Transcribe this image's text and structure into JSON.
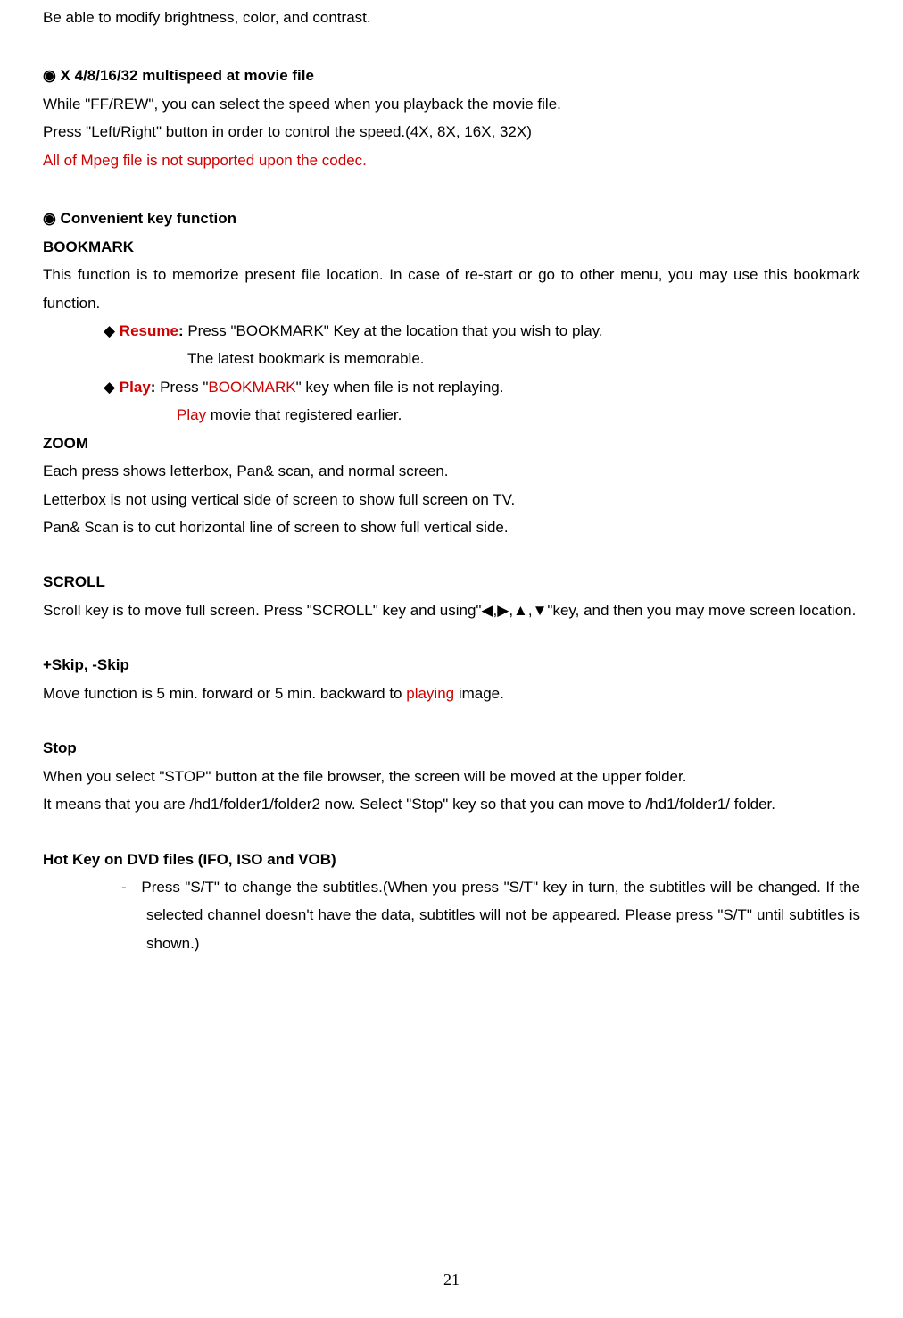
{
  "intro": "Be able to modify brightness, color, and contrast.",
  "sec1": {
    "title": "◉ X 4/8/16/32 multispeed at movie file",
    "l1": "While \"FF/REW\", you can select the speed when you playback the movie file.",
    "l2": "Press \"Left/Right\" button in order to control the speed.(4X, 8X, 16X, 32X)",
    "l3": "All of Mpeg file is not supported upon the codec."
  },
  "sec2": {
    "title": "◉ Convenient key function",
    "bookmark": {
      "h": "BOOKMARK",
      "desc": "This function is to memorize present file location. In case of re-start or go to other menu, you may use this bookmark function.",
      "resume_label": "Resume",
      "resume_rest": ": Press \"BOOKMARK\" Key at the location that you wish to play.",
      "resume_cont": "The latest bookmark is memorable.",
      "play_label": "Play",
      "play_pre": ": Press \"",
      "play_mid": "BOOKMARK",
      "play_post": "\" key when file is not replaying.",
      "play_cont_pre": "Play",
      "play_cont_post": " movie that registered earlier."
    },
    "zoom": {
      "h": "ZOOM",
      "l1": "Each press shows letterbox, Pan& scan, and normal screen.",
      "l2": "Letterbox is not using vertical side of screen to show full screen on TV.",
      "l3": "Pan& Scan is to cut horizontal line of screen to show full vertical side."
    },
    "scroll": {
      "h": "SCROLL",
      "desc": "Scroll key is to move full screen. Press  \"SCROLL\" key and using\"◀,▶,▲,▼\"key, and then you may move screen location."
    },
    "skip": {
      "h": "+Skip, -Skip",
      "pre": "Move function is 5 min. forward or 5 min. backward to ",
      "mid": "playing",
      "post": " image."
    },
    "stop": {
      "h": "Stop",
      "l1": "When you select \"STOP\" button at the file browser, the screen will be moved at the upper folder.",
      "l2": "It means that you are /hd1/folder1/folder2 now. Select \"Stop\" key so that you can move to /hd1/folder1/ folder."
    },
    "hotkey": {
      "h": "Hot Key on DVD files (IFO, ISO and VOB)",
      "dash": "-",
      "b1": "Press \"S/T\" to change the subtitles.(When you press \"S/T\" key in turn, the subtitles will be changed. If the selected channel doesn't have the data, subtitles will not be appeared. Please press \"S/T\" until subtitles is shown.)"
    }
  },
  "page_num": "21"
}
